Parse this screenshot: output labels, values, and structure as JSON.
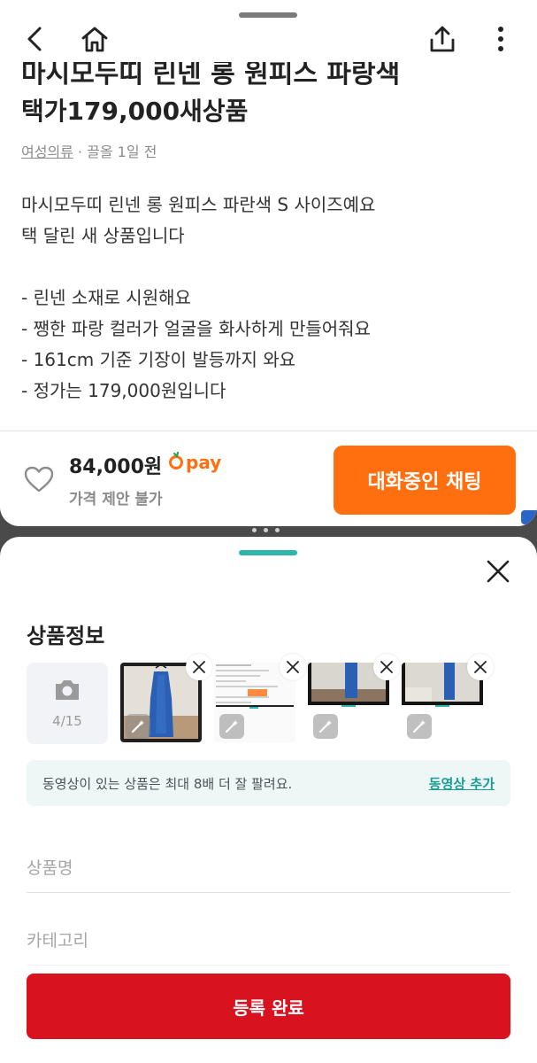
{
  "listing": {
    "title_cut": "마시모두띠 린넨 롱 원피스 파랑색",
    "title_line2": "택가179,000새상품",
    "category": "여성의류",
    "location_time": " · 끌올 1일 전",
    "description_lines": [
      "마시모두띠 린넨 롱 원피스 파란색 S 사이즈예요",
      "택 달린 새 상품입니다",
      "",
      "- 린넨 소재로 시원해요",
      "- 쨍한 파랑 컬러가 얼굴을 화사하게 만들어줘요",
      "- 161cm 기준 기장이 발등까지 와요",
      "- 정가는 179,000원입니다"
    ],
    "price": "84,000원",
    "pay_label": "pay",
    "negotiation": "가격 제안 불가",
    "chat_button": "대화중인 채팅"
  },
  "topnav": {
    "icons": [
      "back-icon",
      "home-icon",
      "share-icon",
      "more-icon"
    ]
  },
  "sheet": {
    "section_title": "상품정보",
    "photo_count": "4/15",
    "photos": [
      {
        "name": "dress-photo-1",
        "kind": "hanger"
      },
      {
        "name": "dress-photo-2",
        "kind": "screenshot"
      },
      {
        "name": "dress-photo-3",
        "kind": "room"
      },
      {
        "name": "dress-photo-4",
        "kind": "room"
      }
    ],
    "video_banner_text": "동영상이 있는 상품은 최대 8배 더 잘 팔려요.",
    "video_link": "동영상 추가",
    "name_placeholder": "상품명",
    "category_placeholder": "카테고리",
    "submit_button": "등록 완료"
  },
  "colors": {
    "brand_orange": "#ff6f0f",
    "teal": "#2fb5ad",
    "submit_red": "#d9121f"
  }
}
